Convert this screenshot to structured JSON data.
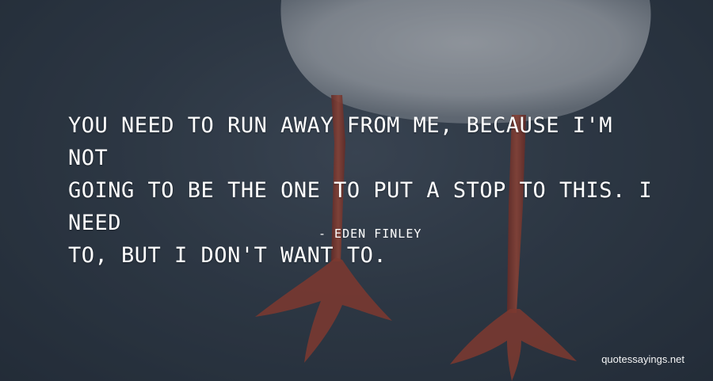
{
  "quote": {
    "lines": [
      "YOU NEED TO RUN AWAY FROM ME, BECAUSE I'M NOT",
      "GOING TO BE THE ONE TO PUT A STOP TO THIS. I NEED",
      "TO, BUT I DON'T WANT TO."
    ]
  },
  "author": "- EDEN FINLEY",
  "watermark": "quotessayings.net",
  "colors": {
    "text": "#ffffff",
    "background": "#37434f",
    "legs": "#b5452f",
    "body": "#d9dde0"
  }
}
